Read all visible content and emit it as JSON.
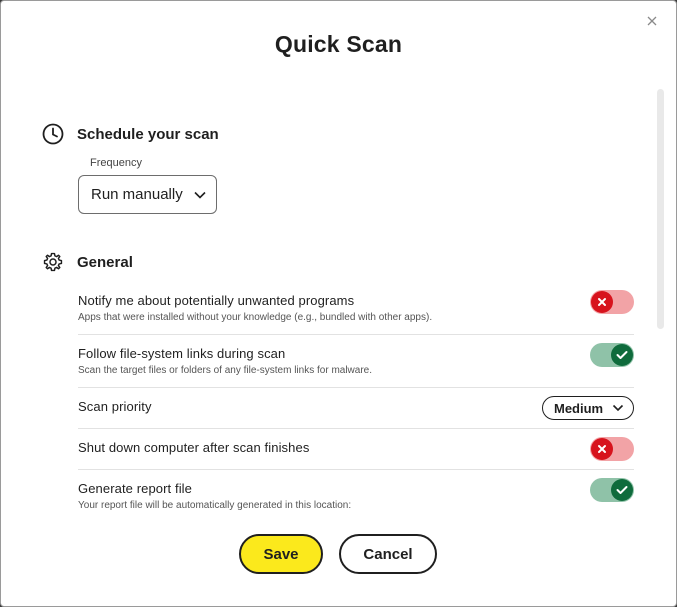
{
  "dialog": {
    "title": "Quick Scan",
    "close_label": "×"
  },
  "schedule": {
    "heading": "Schedule your scan",
    "icon": "clock-icon",
    "frequency_label": "Frequency",
    "frequency_value": "Run manually"
  },
  "general": {
    "heading": "General",
    "icon": "gear-icon",
    "rows": [
      {
        "title": "Notify me about potentially unwanted programs",
        "subtitle": "Apps that were installed without your knowledge (e.g., bundled with other apps).",
        "state": "off"
      },
      {
        "title": "Follow file-system links during scan",
        "subtitle": "Scan the target files or folders of any file-system links for malware.",
        "state": "on"
      },
      {
        "title": "Scan priority",
        "value": "Medium"
      },
      {
        "title": "Shut down computer after scan finishes",
        "state": "off"
      },
      {
        "title": "Generate report file",
        "subtitle": "Your report file will be automatically generated in this location:",
        "state": "on"
      }
    ]
  },
  "footer": {
    "save_label": "Save",
    "cancel_label": "Cancel"
  },
  "colors": {
    "save_button": "#fbe91c",
    "toggle_off_track": "#f2a3a6",
    "toggle_off_knob": "#d7131d",
    "toggle_on_track": "#8fc2a8",
    "toggle_on_knob": "#0f6b3c"
  }
}
